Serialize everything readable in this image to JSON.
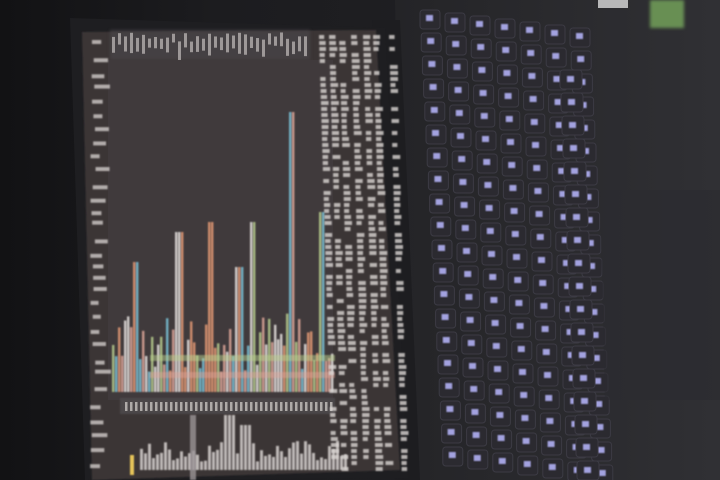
{
  "scene": {
    "subject": "laptop-screen-and-backlit-keyboard",
    "orientation": "rotated",
    "colors": {
      "room": "#161618",
      "laptop_body": "#2a2a2d",
      "bezel": "#1f1f22",
      "screen_bg": "#3a3436",
      "chart_bg": "#403a3c",
      "panel_text": "#d9d4d2",
      "bar_orange": "#e79b76",
      "bar_cyan": "#79c4d9",
      "bar_green": "#b9cf8e",
      "bar_pink": "#e0a79a",
      "bar_white": "#e9e4e2",
      "bar_yellow": "#e6c45a",
      "key_cap": "#2b2a30",
      "key_glow": "#b9b8ff",
      "status_light": "#8fd06a"
    }
  }
}
